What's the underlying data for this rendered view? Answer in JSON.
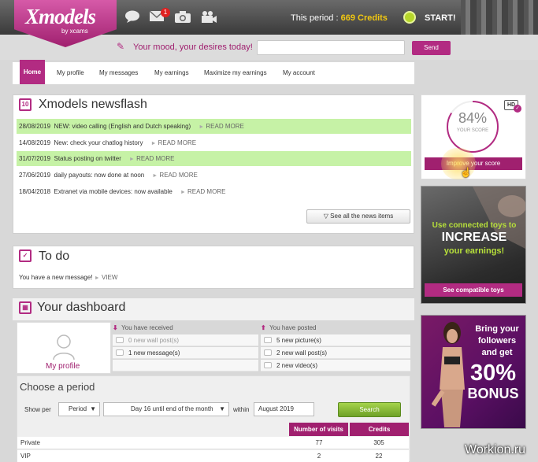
{
  "header": {
    "logo_main": "Xmodels",
    "logo_sub": "by xcams",
    "mail_badge": "1",
    "period_label": "This period : ",
    "period_value": "669 Credits",
    "start_label": "START!"
  },
  "mood": {
    "prompt": "Your mood, your desires today!",
    "input_value": "",
    "send_label": "Send"
  },
  "nav": {
    "items": [
      "Home",
      "My profile",
      "My messages",
      "My earnings",
      "Maximize my earnings",
      "My account"
    ]
  },
  "newsflash": {
    "title": "Xmodels newsflash",
    "icon_day": "10",
    "items": [
      {
        "date": "28/08/2019",
        "text": "NEW: video calling (English and Dutch speaking)",
        "more": "READ MORE"
      },
      {
        "date": "14/08/2019",
        "text": "New: check your chatlog history",
        "more": "READ MORE"
      },
      {
        "date": "31/07/2019",
        "text": "Status posting on twitter",
        "more": "READ MORE"
      },
      {
        "date": "27/06/2019",
        "text": "daily payouts: now done at noon",
        "more": "READ MORE"
      },
      {
        "date": "18/04/2018",
        "text": "Extranet via mobile devices: now available",
        "more": "READ MORE"
      }
    ],
    "see_all": "See all the news items"
  },
  "todo": {
    "title": "To do",
    "message": "You have a new message!",
    "view": "VIEW"
  },
  "dashboard": {
    "title": "Your dashboard",
    "profile_label": "My profile",
    "received_title": "You have received",
    "received": [
      "0 new wall post(s)",
      "1 new message(s)"
    ],
    "posted_title": "You have posted",
    "posted": [
      "5 new picture(s)",
      "2 new wall post(s)",
      "2 new video(s)"
    ]
  },
  "period": {
    "title": "Choose a period",
    "show_per": "Show per",
    "per_value": "Period",
    "range_value": "Day 16 until end of the month",
    "within": "within",
    "month_value": "August 2019",
    "search": "Search",
    "columns": [
      "Number of visits",
      "Credits"
    ],
    "rows": [
      {
        "name": "Private",
        "visits": "77",
        "credits": "305"
      },
      {
        "name": "VIP",
        "visits": "2",
        "credits": "22"
      }
    ]
  },
  "score": {
    "percent": "84%",
    "percent_value": 84,
    "label": "YOUR SCORE",
    "hd": "HD",
    "improve": "Improve your score"
  },
  "toys_banner": {
    "line1": "Use connected toys to",
    "line2": "INCREASE",
    "line3": "your earnings!",
    "button": "See compatible toys"
  },
  "bonus_banner": {
    "line1": "Bring your",
    "line2": "followers",
    "line3": "and get",
    "line4": "30%",
    "line5": "BONUS"
  },
  "watermark": "Workion.ru",
  "colors": {
    "brand": "#b22b82",
    "highlight_row": "#c6f2a6",
    "credits": "#f2c811",
    "search": "#7cb32f"
  }
}
